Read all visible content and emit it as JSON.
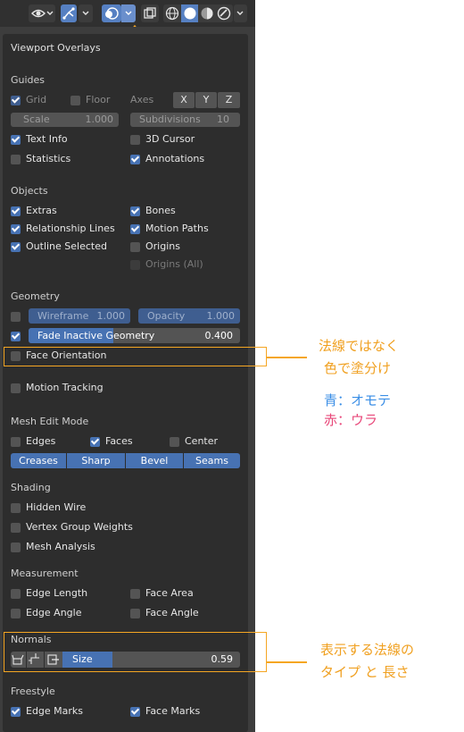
{
  "panel": {
    "title": "Viewport Overlays",
    "guides": {
      "heading": "Guides",
      "grid": "Grid",
      "floor": "Floor",
      "axes": "Axes",
      "x": "X",
      "y": "Y",
      "z": "Z",
      "scale_label": "Scale",
      "scale_value": "1.000",
      "subdivisions_label": "Subdivisions",
      "subdivisions_value": "10",
      "text_info": "Text Info",
      "cursor_3d": "3D Cursor",
      "statistics": "Statistics",
      "annotations": "Annotations"
    },
    "objects": {
      "heading": "Objects",
      "extras": "Extras",
      "bones": "Bones",
      "relationship_lines": "Relationship Lines",
      "motion_paths": "Motion Paths",
      "outline_selected": "Outline Selected",
      "origins": "Origins",
      "origins_all": "Origins (All)"
    },
    "geometry": {
      "heading": "Geometry",
      "wireframe_label": "Wireframe",
      "wireframe_value": "1.000",
      "opacity_label": "Opacity",
      "opacity_value": "1.000",
      "fade_label": "Fade Inactive Geometry",
      "fade_value": "0.400",
      "face_orientation": "Face Orientation",
      "motion_tracking": "Motion Tracking"
    },
    "mesh_edit": {
      "heading": "Mesh Edit Mode",
      "edges": "Edges",
      "faces": "Faces",
      "center": "Center",
      "creases": "Creases",
      "sharp": "Sharp",
      "bevel": "Bevel",
      "seams": "Seams"
    },
    "shading": {
      "heading": "Shading",
      "hidden_wire": "Hidden Wire",
      "vertex_group_weights": "Vertex Group Weights",
      "mesh_analysis": "Mesh Analysis"
    },
    "measurement": {
      "heading": "Measurement",
      "edge_length": "Edge Length",
      "face_area": "Face Area",
      "edge_angle": "Edge Angle",
      "face_angle": "Face Angle"
    },
    "normals": {
      "heading": "Normals",
      "size_label": "Size",
      "size_value": "0.59",
      "size_fill": 0.2
    },
    "freestyle": {
      "heading": "Freestyle",
      "edge_marks": "Edge Marks",
      "face_marks": "Face Marks"
    }
  },
  "notes": {
    "face_orientation_1": "法線ではなく",
    "face_orientation_2": "色で塗分け",
    "blue_note": "青：オモテ",
    "red_note": "赤：ウラ",
    "normals_1": "表示する法線の",
    "normals_2": "タイプ と 長さ"
  },
  "colors": {
    "accent": "#4772b3",
    "annotation": "#f5a623",
    "blue_text": "#3a8ee6",
    "red_text": "#e8487a"
  }
}
